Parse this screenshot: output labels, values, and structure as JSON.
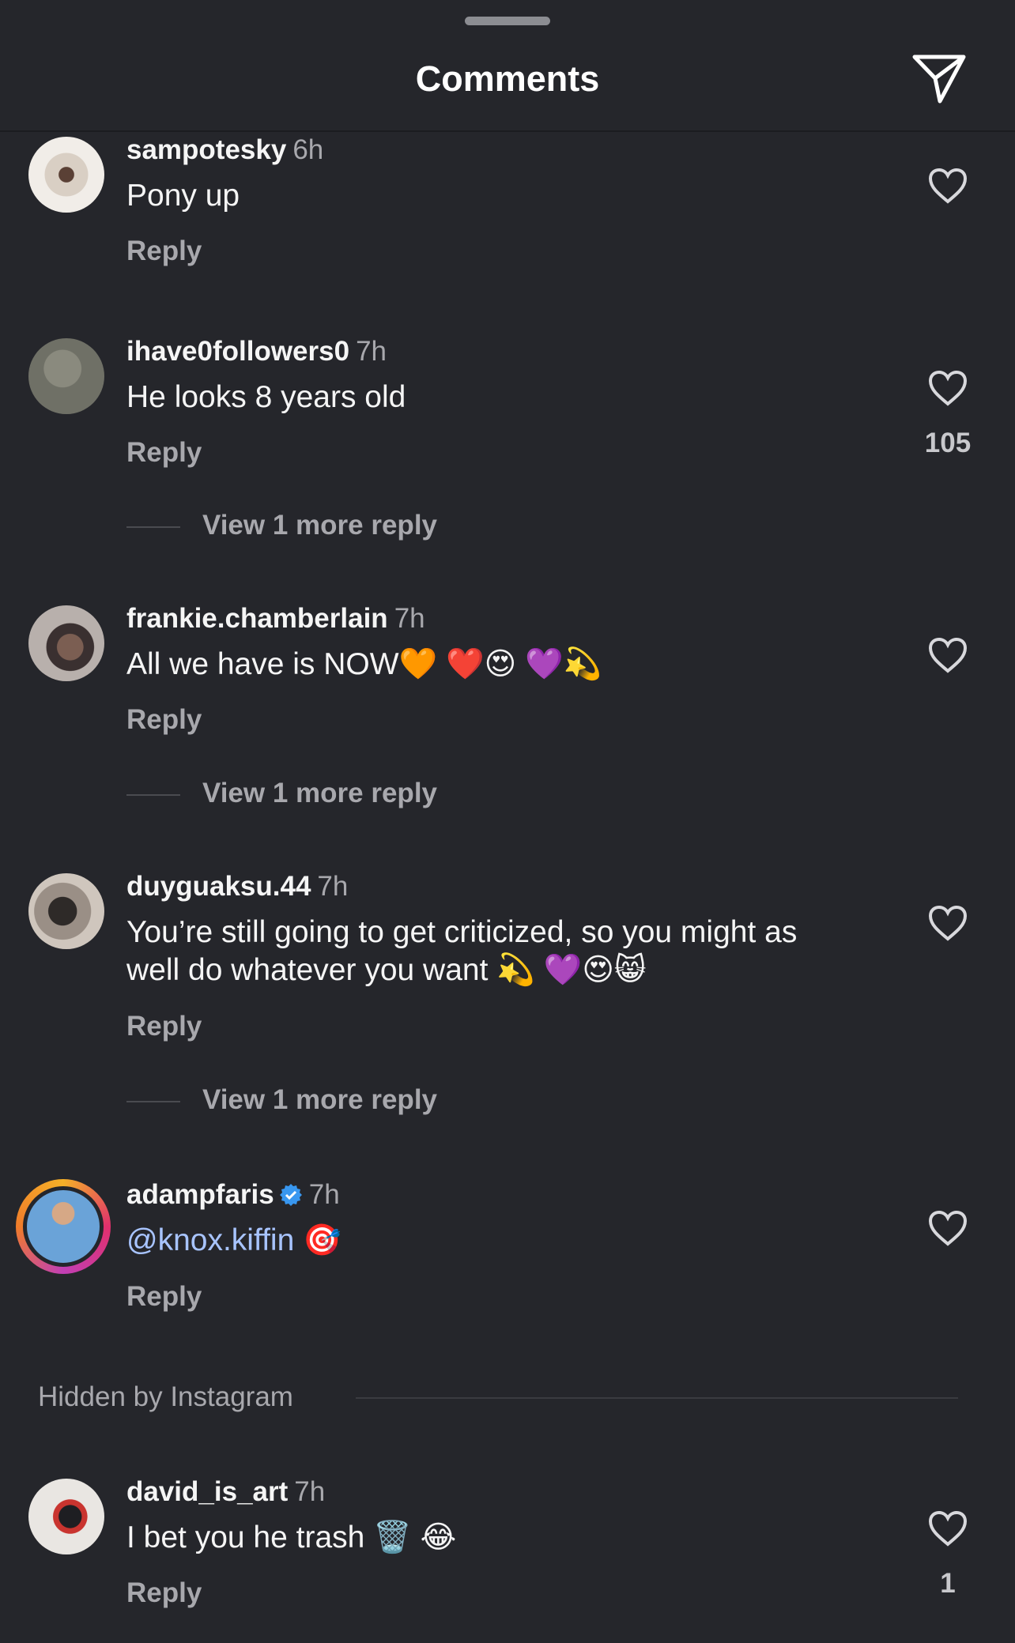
{
  "header": {
    "title": "Comments",
    "share_icon": "send-icon"
  },
  "comments": [
    {
      "username": "sampotesky",
      "time": "6h",
      "text": "Pony up",
      "reply_label": "Reply",
      "likes": ""
    },
    {
      "username": "ihave0followers0",
      "time": "7h",
      "text": "He looks 8 years old",
      "reply_label": "Reply",
      "likes": "105",
      "view_more": "View 1 more reply"
    },
    {
      "username": "frankie.chamberlain",
      "time": "7h",
      "text": "All we have is NOW🧡 ❤️😍 💜💫",
      "reply_label": "Reply",
      "likes": "",
      "view_more": "View 1 more reply"
    },
    {
      "username": "duyguaksu.44",
      "time": "7h",
      "text": "You’re still going to get criticized, so you might as well do whatever you want 💫 💜😍😸",
      "reply_label": "Reply",
      "likes": "",
      "view_more": "View 1 more reply"
    },
    {
      "username": "adampfaris",
      "time": "7h",
      "verified": true,
      "text_mention": "@knox.kiffin",
      "text_emoji": "🎯",
      "reply_label": "Reply",
      "likes": ""
    },
    {
      "username": "david_is_art",
      "time": "7h",
      "text": "I bet you he trash 🗑️ 😂",
      "reply_label": "Reply",
      "likes": "1"
    }
  ],
  "hidden_section": {
    "label": "Hidden by Instagram"
  },
  "colors": {
    "background": "#25262b",
    "mention": "#a8c4ff",
    "verified": "#3897f0",
    "muted": "#a8a8ad"
  }
}
